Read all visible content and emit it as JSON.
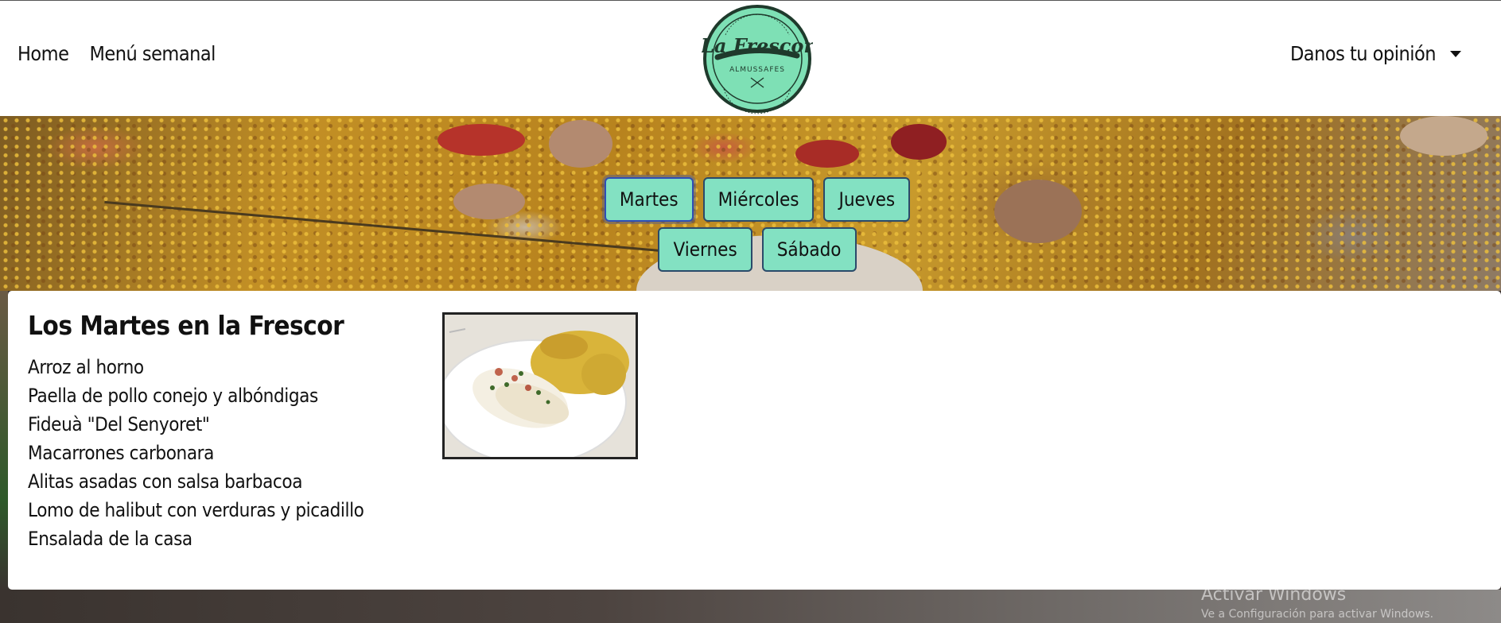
{
  "nav": {
    "home": "Home",
    "weekly_menu": "Menú semanal",
    "feedback": "Danos tu opinión"
  },
  "logo": {
    "name": "La Frescor",
    "town": "ALMUSSAFES",
    "brand_color": "#7ee0b5"
  },
  "days": [
    "Martes",
    "Miércoles",
    "Jueves",
    "Viernes",
    "Sábado"
  ],
  "selected_day": "Martes",
  "menu": {
    "title": "Los Martes en la Frescor",
    "dishes": [
      "Arroz al horno",
      "Paella de pollo conejo y albóndigas",
      "Fideuà \"Del Senyoret\"",
      "Macarrones carbonara",
      "Alitas asadas con salsa barbacoa",
      "Lomo de halibut con verduras y picadillo",
      "Ensalada de la casa"
    ]
  },
  "watermark": {
    "line1": "Activar Windows",
    "line2": "Ve a Configuración para activar Windows."
  },
  "colors": {
    "button_bg": "#83e1c2",
    "button_border": "#2b4a6a",
    "active_border": "#2e4fb6"
  }
}
